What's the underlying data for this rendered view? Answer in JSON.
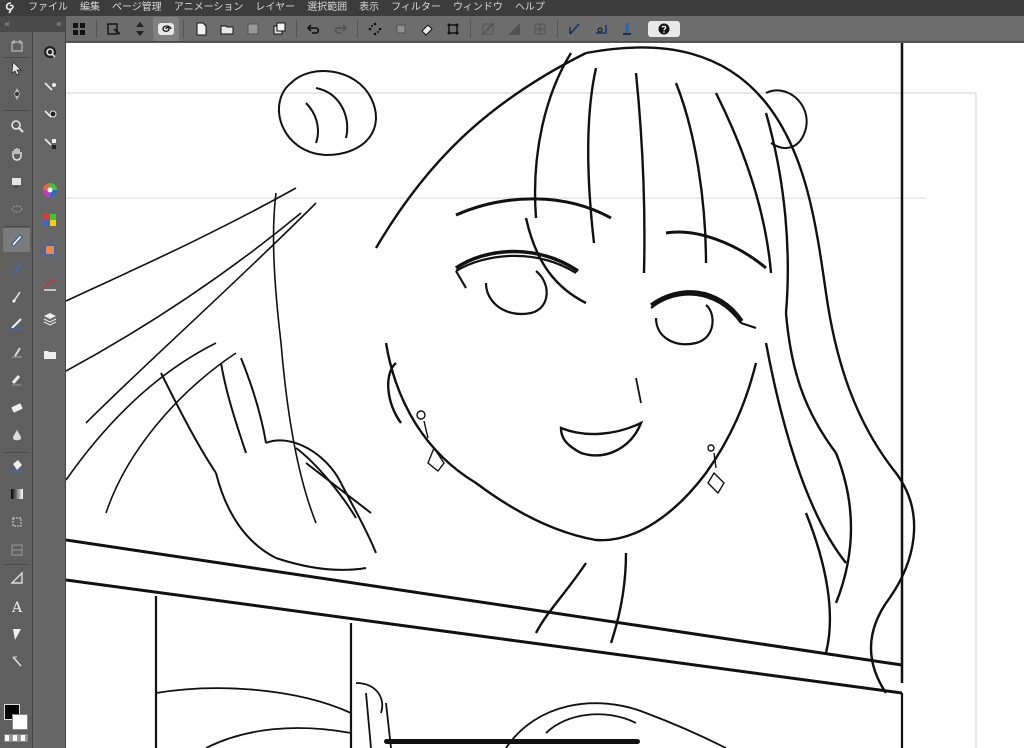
{
  "app": {
    "logo_icon": "clip-studio-logo-icon"
  },
  "menu": {
    "items": [
      "ファイル",
      "編集",
      "ページ管理",
      "アニメーション",
      "レイヤー",
      "選択範囲",
      "表示",
      "フィルター",
      "ウィンドウ",
      "ヘルプ"
    ]
  },
  "collapse": {
    "left": "«",
    "right": "«"
  },
  "command_bar": {
    "tools": [
      "grid-icon",
      "paste-icon",
      "swap-icon",
      "spiral-icon",
      "new-file-icon",
      "open-file-icon",
      "save-icon",
      "copy-icon",
      "undo-icon",
      "redo-icon",
      "transform-dots-icon",
      "move-icon",
      "fill-icon",
      "crop-icon",
      "snap-off-icon",
      "snap-special-icon",
      "grid-snap-icon",
      "ruler-snap-icon",
      "perspective-snap-icon",
      "stabilizer-icon"
    ],
    "help_icon": "help-icon"
  },
  "tool_rail": [
    "move-layer-icon",
    "operation-icon",
    "zoom-icon",
    "hand-icon",
    "rotate-icon",
    "lasso-icon",
    "pen-icon",
    "pencil-icon",
    "brush-icon",
    "airbrush-icon",
    "decoration-icon",
    "eraser-icon",
    "blend-icon",
    "fill-bucket-icon",
    "gradient-icon",
    "figure-icon",
    "frame-icon",
    "ruler-icon",
    "text-icon",
    "balloon-icon",
    "correction-icon"
  ],
  "sub_rail": [
    "search-icon",
    "sub-tool-icon",
    "settings-icon",
    "layer-props-icon",
    "color-wheel-icon",
    "color-set-icon",
    "animation-icon",
    "brush-size-icon",
    "layers-icon",
    "material-folder-icon"
  ],
  "colors": {
    "foreground": "#000000",
    "background": "#ffffff"
  }
}
